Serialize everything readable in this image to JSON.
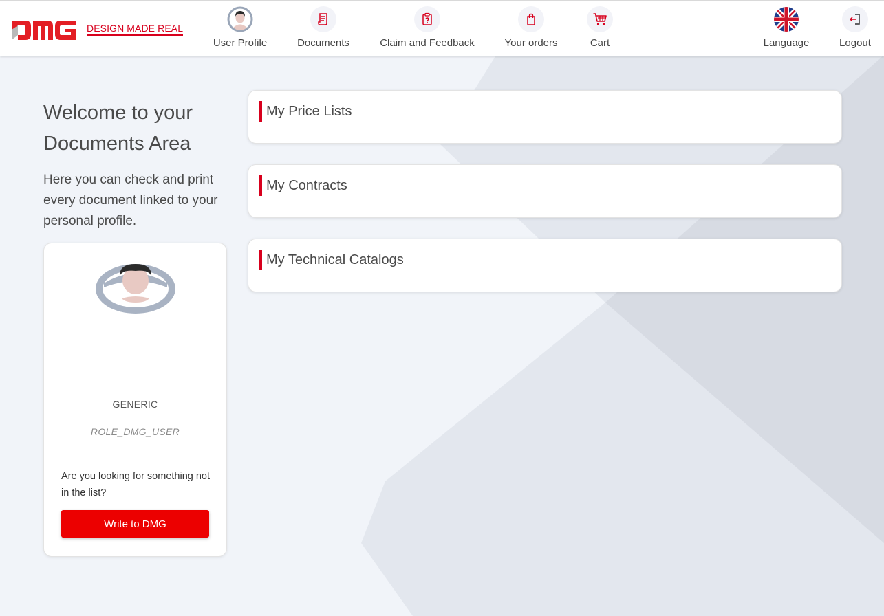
{
  "brand": {
    "logo_text": "DMG",
    "tagline": "DESIGN MADE REAL",
    "accent_color": "#d8001d"
  },
  "nav": {
    "items": [
      {
        "label": "User Profile",
        "icon": "user-avatar-icon"
      },
      {
        "label": "Documents",
        "icon": "document-icon"
      },
      {
        "label": "Claim and Feedback",
        "icon": "clipboard-icon"
      },
      {
        "label": "Your orders",
        "icon": "shopping-bag-icon"
      },
      {
        "label": "Cart",
        "icon": "cart-icon"
      }
    ],
    "right": [
      {
        "label": "Language",
        "icon": "uk-flag-icon"
      },
      {
        "label": "Logout",
        "icon": "logout-icon"
      }
    ]
  },
  "welcome": {
    "title": "Welcome to your Documents Area",
    "text": "Here you can check and print every document linked to your personal profile."
  },
  "profile": {
    "name": "GENERIC",
    "role": "ROLE_DMG_USER",
    "help_text": "Are you looking for something not in the list?",
    "button_label": "Write to DMG"
  },
  "documents": [
    {
      "title": "My Price Lists"
    },
    {
      "title": "My Contracts"
    },
    {
      "title": "My Technical Catalogs"
    }
  ]
}
